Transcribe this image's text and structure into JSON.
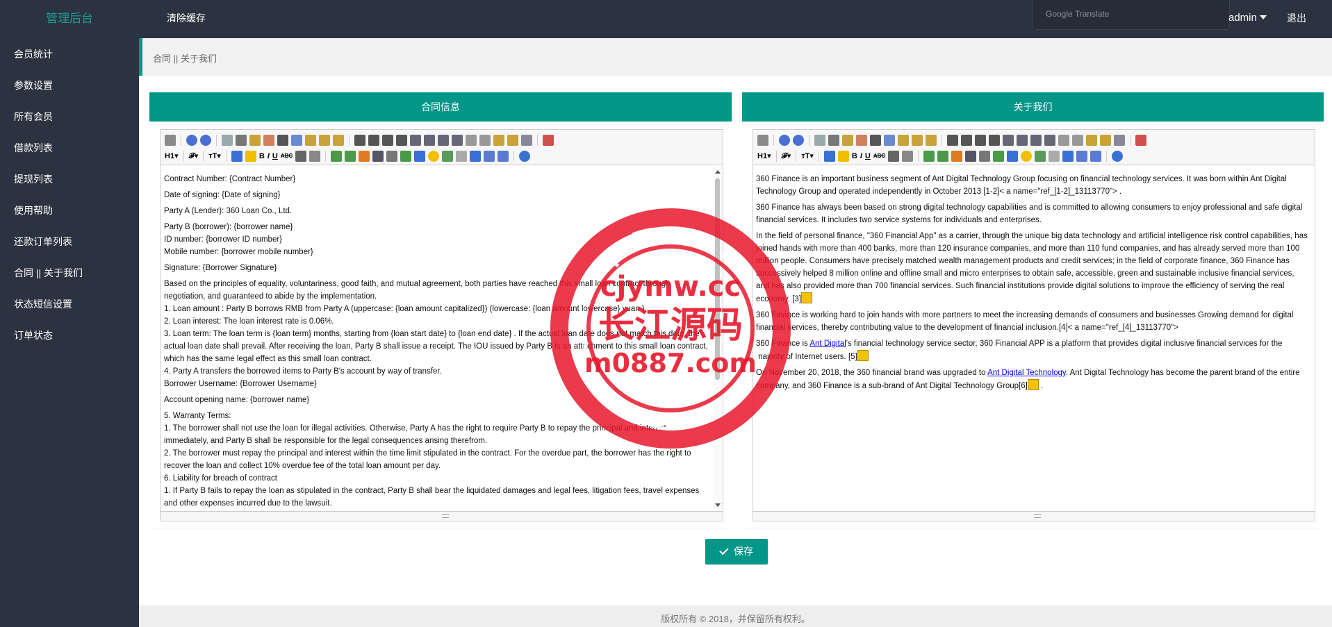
{
  "header": {
    "brand": "管理后台",
    "clear_cache": "清除缓存",
    "translate_label": "Google Translate",
    "user": "admin",
    "logout": "退出"
  },
  "sidebar": {
    "items": [
      {
        "label": "会员统计"
      },
      {
        "label": "参数设置"
      },
      {
        "label": "所有会员"
      },
      {
        "label": "借款列表"
      },
      {
        "label": "提现列表"
      },
      {
        "label": "使用帮助"
      },
      {
        "label": "还款订单列表"
      },
      {
        "label": "合同 || 关于我们"
      },
      {
        "label": "状态短信设置"
      },
      {
        "label": "订单状态"
      }
    ]
  },
  "breadcrumb": "合同 || 关于我们",
  "contract_panel": {
    "title": "合同信息",
    "paragraphs": [
      "Contract Number: {Contract Number}",
      "Date of signing: {Date of signing}",
      "Party A (Lender): 360 Loan Co., Ltd.",
      "Party B (borrower): {borrower name}\nID number: {borrower ID number}\nMobile number: {borrower mobile number}",
      "Signature: {Borrower Signature}",
      "Based on the principles of equality, voluntariness, good faith, and mutual agreement, both parties have reached this small loan contract through negotiation, and guaranteed to abide by the implementation.\n1. Loan amount : Party B borrows RMB from Party A (uppercase: {loan amount capitalized})  (lowercase: {loan amount lowercase} yuan ).\n2. Loan interest: The loan interest rate is 0.06%.\n3. Loan term: The loan term is {loan term} months, starting from  {loan start date} to  {loan end date} . If the actual loan date does not match this date, the actual loan date shall prevail. After receiving the loan, Party B shall issue a receipt. The IOU issued by Party B is an attachment to this small loan contract, which has the same legal effect as this small loan contract.\n4. Party A transfers the borrowed items to Party B's account by way of transfer.\nBorrower Username: {Borrower Username}",
      "Account opening name: {borrower name}",
      "5. Warranty Terms:\n1. The borrower shall not use the loan for illegal activities. Otherwise, Party A has the right to require Party B to repay the principal and interest immediately, and Party B shall be responsible for the legal consequences arising therefrom.\n2. The borrower must repay the principal and interest within the time limit stipulated in the contract. For the overdue part, the borrower has the right to recover the loan and collect  10% overdue fee  of the total loan amount per day.\n6. Liability for breach of contract\n1. If Party B fails to repay the loan as stipulated in the contract, Party B shall bear the liquidated damages and legal fees, litigation fees, travel expenses and other expenses incurred due to the lawsuit."
    ]
  },
  "about_panel": {
    "title": "关于我们",
    "p1": "360 Finance is an important business segment of Ant Digital Technology Group focusing on financial technology services. It was born within Ant Digital Technology Group and operated independently in October 2013 [1-2]< a name=\"ref_[1-2]_13113770\"> .",
    "p2": "360 Finance has always been based on strong digital technology capabilities and is committed to allowing consumers to enjoy professional and safe digital financial services. It includes two service systems for individuals and enterprises.",
    "p3": "In the field of personal finance, \"360 Financial App\" as a carrier, through the unique big data technology and artificial intelligence risk control capabilities, has joined hands with more than 400 banks, more than 120 insurance companies, and more than 110 fund companies, and has already served more than 100 million people. Consumers have precisely matched wealth management products and credit services; in the field of corporate finance, 360 Finance has successively helped 8 million online and offline small and micro enterprises to obtain safe, accessible, green and sustainable inclusive financial services, and has also provided more than 700 financial services. Such financial institutions provide digital solutions to improve the efficiency of serving the real economy. [3]",
    "p4": "360 Finance is working hard to join hands with more partners to meet the increasing demands of consumers and businesses Growing demand for digital financial services, thereby contributing value to the development of financial inclusion.[4]< a name=\"ref_[4]_13113770\">",
    "p5_a": "360 Finance is ",
    "p5_link": "Ant Digital",
    "p5_b": "'s financial technology service sector, 360 Financial APP is a platform that provides digital inclusive financial services for the majority of Internet users. [5]",
    "p6_a": "On November 20, 2018, the 360 financial brand was upgraded to ",
    "p6_link": "Ant Digital Technology",
    "p6_b": ". Ant Digital Technology has become the parent brand of the entire company, and 360 Finance is a sub-brand of Ant Digital Technology Group[6]",
    "p6_c": " ."
  },
  "toolbar": {
    "heading": "H1",
    "font": "𝓕",
    "size": "тT",
    "bold": "B",
    "italic": "I",
    "underline": "U",
    "strike": "ABC"
  },
  "save_label": "保存",
  "footer": "版权所有 © 2018，并保留所有权利。",
  "watermark": {
    "line1": "cjymw.cc",
    "line2": "长江源码",
    "line3": "m0887.com"
  },
  "colors": {
    "accent": "#009688",
    "dark": "#2b3240",
    "brand_text": "#1aa094",
    "watermark": "#e8182c"
  }
}
